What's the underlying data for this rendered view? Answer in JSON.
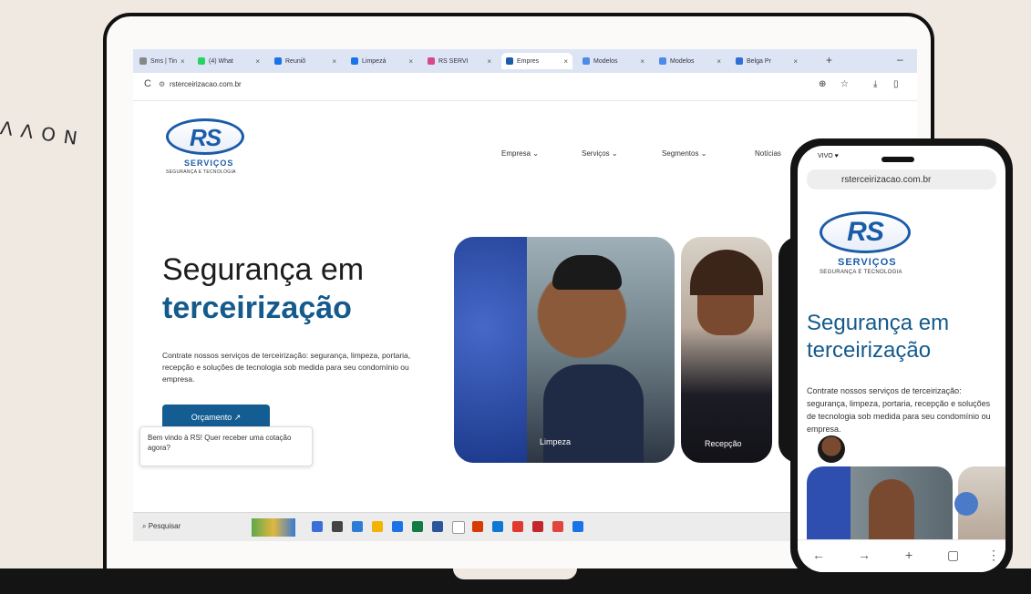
{
  "corner_text": "ΛΛΟΝ",
  "browser": {
    "tabs": [
      {
        "label": "Sms | Tin",
        "color": "#888888"
      },
      {
        "label": "(4) What",
        "color": "#25d366"
      },
      {
        "label": "Reuniõ",
        "color": "#1a73e8"
      },
      {
        "label": "Limpezá",
        "color": "#1a73e8"
      },
      {
        "label": "RS SERVI",
        "color": "#d44a8a"
      },
      {
        "label": "Empres",
        "color": "#1a5ca8"
      },
      {
        "label": "Modelos",
        "color": "#4a8ce8"
      },
      {
        "label": "Modelos",
        "color": "#4a8ce8"
      },
      {
        "label": "Belga Pr",
        "color": "#2f6fd6"
      }
    ],
    "close_glyph": "×",
    "new_tab": "+",
    "minimize": "–",
    "reload": "C",
    "url_icon": "⚙",
    "url": "rsterceirizacao.com.br",
    "toolbar_icons": [
      "⊕",
      "☆",
      "⤓",
      "▯"
    ]
  },
  "site": {
    "logo_mark": "RS",
    "logo_word": "SERVIÇOS",
    "logo_sub": "SEGURANÇA E TECNOLOGIA",
    "menu": [
      "Empresa ⌄",
      "Serviços ⌄",
      "Segmentos ⌄",
      "Notícias"
    ],
    "hero_title_1": "Segurança em",
    "hero_title_2": "terceirização",
    "hero_text": "Contrate nossos serviços de terceirização: segurança, limpeza, portaria, recepção e soluções de tecnologia sob medida para seu condomínio ou empresa.",
    "cta": "Orçamento ↗",
    "chat": "Bem vindo à RS! Quer receber uma cotação agora?",
    "card_labels": [
      "Limpeza",
      "Recepção"
    ]
  },
  "taskbar": {
    "search": "⌕ Pesquisar",
    "icons": [
      "#3a6fd8",
      "#444444",
      "#2d7cd6",
      "#f2b400",
      "#1a73e8",
      "#107c41",
      "#2b579a",
      "#ffffff",
      "#d83b01",
      "#0f78d4",
      "#e03a2f",
      "#c4262e",
      "#e2453c",
      "#1a73e8"
    ]
  },
  "phone": {
    "status": "VIVO ♥",
    "url": "rsterceirizacao.com.br",
    "title": "Segurança em terceirização",
    "text": "Contrate nossos serviços de terceirização: segurança, limpeza, portaria, recepção e soluções de tecnologia sob medida para seu condomínio ou empresa.",
    "nav": [
      "←",
      "→",
      "+",
      "▢",
      "⋮"
    ]
  }
}
